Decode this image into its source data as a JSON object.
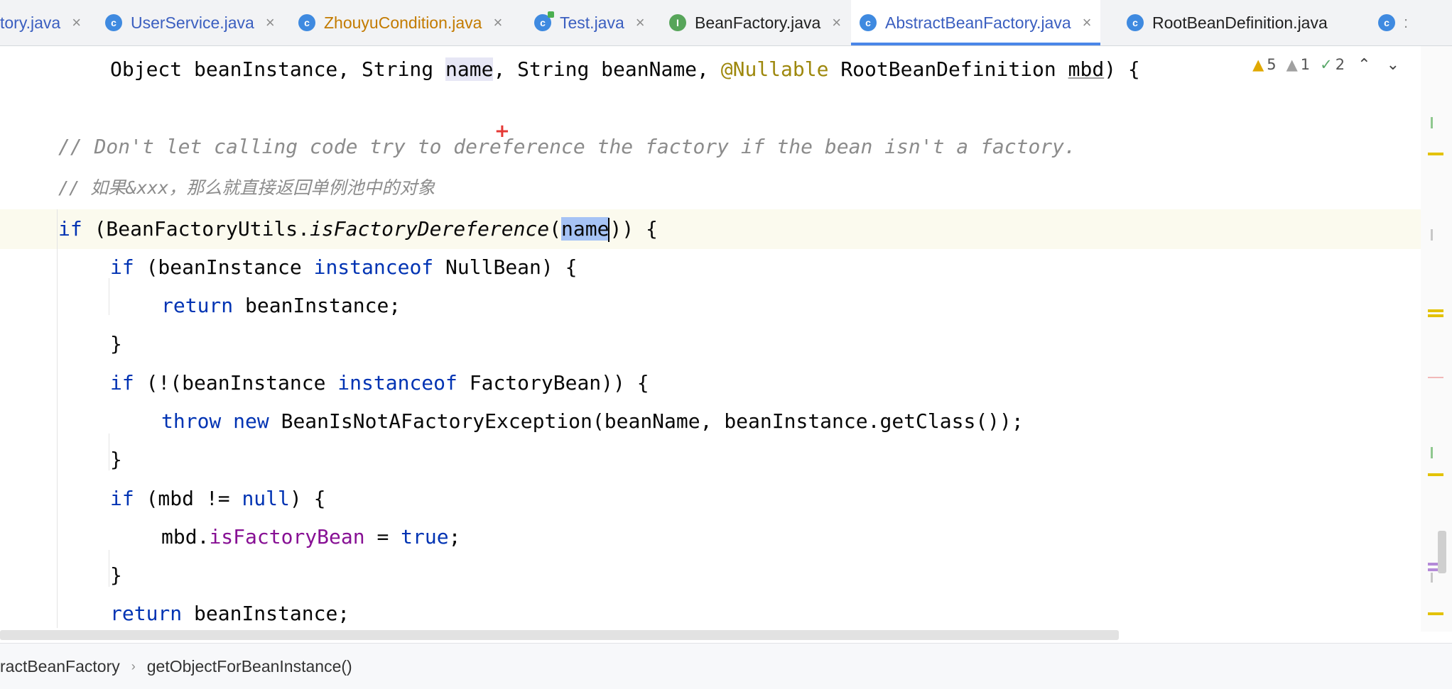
{
  "tabs": [
    {
      "label": "tory.java",
      "icon": "class",
      "color": "#3b5fc0",
      "close": "×"
    },
    {
      "label": "UserService.java",
      "icon": "class",
      "color": "#3b5fc0",
      "close": "×"
    },
    {
      "label": "ZhouyuCondition.java",
      "icon": "class",
      "color": "#c37b00",
      "close": "×"
    },
    {
      "label": "Test.java",
      "icon": "test-class",
      "color": "#3b5fc0",
      "close": "×"
    },
    {
      "label": "BeanFactory.java",
      "icon": "interface",
      "color": "#222222",
      "close": "×"
    },
    {
      "label": "AbstractBeanFactory.java",
      "icon": "class",
      "color": "#3b5fc0",
      "close": "×",
      "active": true
    },
    {
      "label": "RootBeanDefinition.java",
      "icon": "class",
      "color": "#222222",
      "close": ""
    },
    {
      "label": "",
      "icon": "class",
      "color": "#222222",
      "close": ":"
    }
  ],
  "inspections": {
    "warnings": "5",
    "weak_warnings": "1",
    "typos": "2"
  },
  "code": {
    "l1": {
      "p1": "Object beanInstance, String ",
      "p2": "name",
      ",": "",
      "p3": ", String beanName, ",
      "ann": "@Nullable",
      "p4": " RootBeanDefinition ",
      "mbd": "mbd",
      "p5": ") {"
    },
    "l2": "// Don't let calling code try to dereference the factory if the bean isn't a factory.",
    "l3": "// 如果&xxx，那么就直接返回单例池中的对象",
    "l4": {
      "kw": "if",
      "p1": " (BeanFactoryUtils.",
      "m": "isFactoryDereference",
      "p2": "(",
      "sel": "name",
      "p3": ")) {"
    },
    "l5": {
      "kw": "if",
      "p1": " (beanInstance ",
      "kw2": "instanceof",
      "p2": " NullBean) {"
    },
    "l6": {
      "kw": "return",
      "p1": " beanInstance;"
    },
    "l7": "}",
    "l8": {
      "kw": "if",
      "p1": " (!(beanInstance ",
      "kw2": "instanceof",
      "p2": " FactoryBean)) {"
    },
    "l9": {
      "kw": "throw",
      "kw2": "new",
      "p1": " BeanIsNotAFactoryException(beanName, beanInstance.getClass());"
    },
    "l10": "}",
    "l11": {
      "kw": "if",
      "p1": " (mbd != ",
      "kw2": "null",
      "p2": ") {"
    },
    "l12": {
      "p1": "mbd.",
      "fld": "isFactoryBean",
      "p2": " = ",
      "kw": "true",
      "p3": ";"
    },
    "l13": "}",
    "l14": {
      "kw": "return",
      "p1": " beanInstance;"
    },
    "l15": "}"
  },
  "breadcrumb": {
    "class": "ractBeanFactory",
    "method": "getObjectForBeanInstance()",
    "sep": "›"
  },
  "colors": {
    "keyword": "#0033b3",
    "annotation": "#9e880d",
    "comment": "#8c8c8c",
    "field": "#871094",
    "selection": "#a6c3f5",
    "active_tab_underline": "#4a86e8"
  }
}
